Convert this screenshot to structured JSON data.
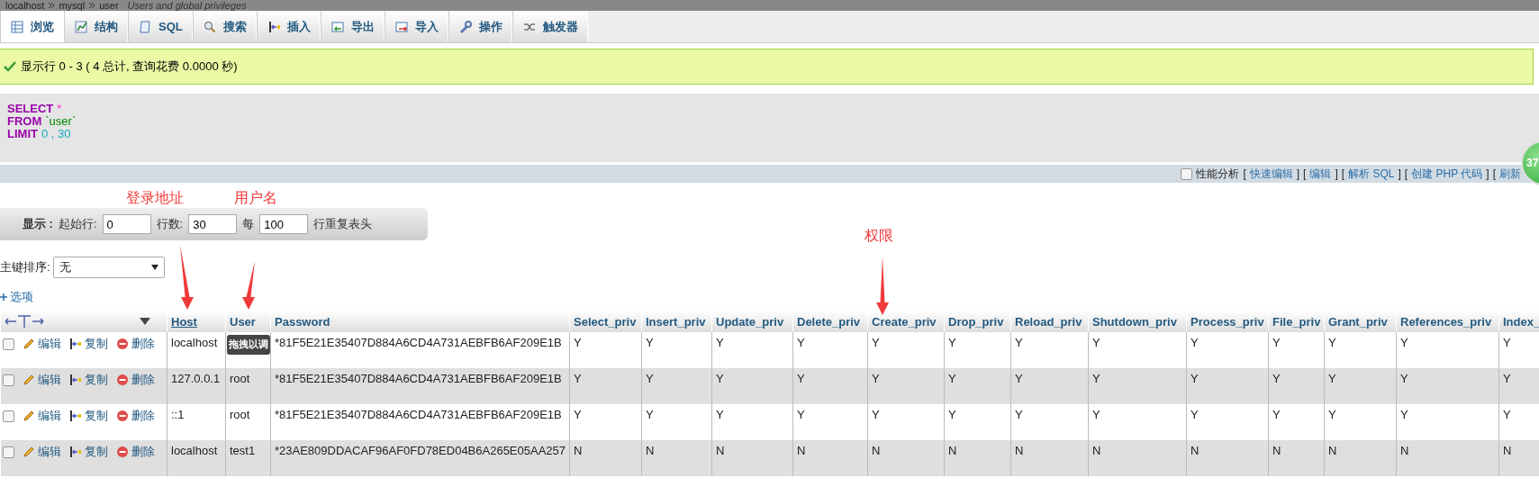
{
  "breadcrumb": {
    "items": [
      "localhost",
      "mysql",
      "user"
    ],
    "subtitle": "Users and global privileges"
  },
  "tabs": [
    {
      "label": "浏览",
      "selected": true
    },
    {
      "label": "结构",
      "selected": false
    },
    {
      "label": "SQL",
      "selected": false
    },
    {
      "label": "搜索",
      "selected": false
    },
    {
      "label": "插入",
      "selected": false
    },
    {
      "label": "导出",
      "selected": false
    },
    {
      "label": "导入",
      "selected": false
    },
    {
      "label": "操作",
      "selected": false
    },
    {
      "label": "触发器",
      "selected": false
    }
  ],
  "message": "显示行 0 - 3 ( 4 总计, 查询花费 0.0000 秒)",
  "sql": [
    [
      {
        "kind": "keyword",
        "text": "SELECT"
      },
      {
        "kind": "operator",
        "text": "*"
      }
    ],
    [
      {
        "kind": "keyword",
        "text": "FROM"
      },
      {
        "kind": "identifier",
        "text": "`user`"
      }
    ],
    [
      {
        "kind": "keyword",
        "text": "LIMIT"
      },
      {
        "kind": "number",
        "text": "0 , 30"
      }
    ]
  ],
  "query_links": {
    "profiling": {
      "label": "性能分析",
      "checked": false
    },
    "links": [
      {
        "open": "[",
        "label": "快速编辑",
        "close": "]"
      },
      {
        "open": "[",
        "label": "编辑",
        "close": "]"
      },
      {
        "open": "[",
        "label": "解析 SQL",
        "close": "]"
      },
      {
        "open": "[",
        "label": "创建 PHP 代码",
        "close": "]"
      },
      {
        "open": "[",
        "label": "刷新"
      }
    ]
  },
  "badge": "37",
  "display": {
    "label": "显示 :",
    "start_label": "起始行:",
    "start": "0",
    "rows_label": "行数:",
    "rows": "30",
    "every_label": "每",
    "every": "100",
    "repeat_label": "行重复表头"
  },
  "sort": {
    "label": "主键排序:",
    "value": "无"
  },
  "options_link": "选项",
  "table": {
    "columns": [
      {
        "label": "Host",
        "underlined": true
      },
      {
        "label": "User",
        "underlined": false
      },
      {
        "label": "Password",
        "underlined": false
      },
      {
        "label": "Select_priv",
        "underlined": false
      },
      {
        "label": "Insert_priv",
        "underlined": false
      },
      {
        "label": "Update_priv",
        "underlined": false
      },
      {
        "label": "Delete_priv",
        "underlined": false
      },
      {
        "label": "Create_priv",
        "underlined": false
      },
      {
        "label": "Drop_priv",
        "underlined": false
      },
      {
        "label": "Reload_priv",
        "underlined": false
      },
      {
        "label": "Shutdown_priv",
        "underlined": false
      },
      {
        "label": "Process_priv",
        "underlined": false
      },
      {
        "label": "File_priv",
        "underlined": false
      },
      {
        "label": "Grant_priv",
        "underlined": false
      },
      {
        "label": "References_priv",
        "underlined": false
      },
      {
        "label": "Index_",
        "underlined": false
      }
    ],
    "rows": [
      {
        "checked": false,
        "actions": [
          "编辑",
          "复制",
          "删除"
        ],
        "cells": [
          "localhost",
          null,
          "*81F5E21E35407D884A6CD4A731AEBFB6AF209E1B",
          "Y",
          "Y",
          "Y",
          "Y",
          "Y",
          "Y",
          "Y",
          "Y",
          "Y",
          "Y",
          "Y",
          "Y",
          "Y"
        ]
      },
      {
        "checked": false,
        "actions": [
          "编辑",
          "复制",
          "删除"
        ],
        "cells": [
          "127.0.0.1",
          "root",
          "*81F5E21E35407D884A6CD4A731AEBFB6AF209E1B",
          "Y",
          "Y",
          "Y",
          "Y",
          "Y",
          "Y",
          "Y",
          "Y",
          "Y",
          "Y",
          "Y",
          "Y",
          "Y"
        ]
      },
      {
        "checked": false,
        "actions": [
          "编辑",
          "复制",
          "删除"
        ],
        "cells": [
          "::1",
          "root",
          "*81F5E21E35407D884A6CD4A731AEBFB6AF209E1B",
          "Y",
          "Y",
          "Y",
          "Y",
          "Y",
          "Y",
          "Y",
          "Y",
          "Y",
          "Y",
          "Y",
          "Y",
          "Y"
        ]
      },
      {
        "checked": false,
        "actions": [
          "编辑",
          "复制",
          "删除"
        ],
        "cells": [
          "localhost",
          "test1",
          "*23AE809DDACAF96AF0FD78ED04B6A265E05AA257",
          "N",
          "N",
          "N",
          "N",
          "N",
          "N",
          "N",
          "N",
          "N",
          "N",
          "N",
          "N",
          "N"
        ]
      }
    ]
  },
  "tooltip": "拖拽以调",
  "annotations": [
    {
      "text": "登录地址"
    },
    {
      "text": "用户名"
    },
    {
      "text": "权限"
    }
  ]
}
